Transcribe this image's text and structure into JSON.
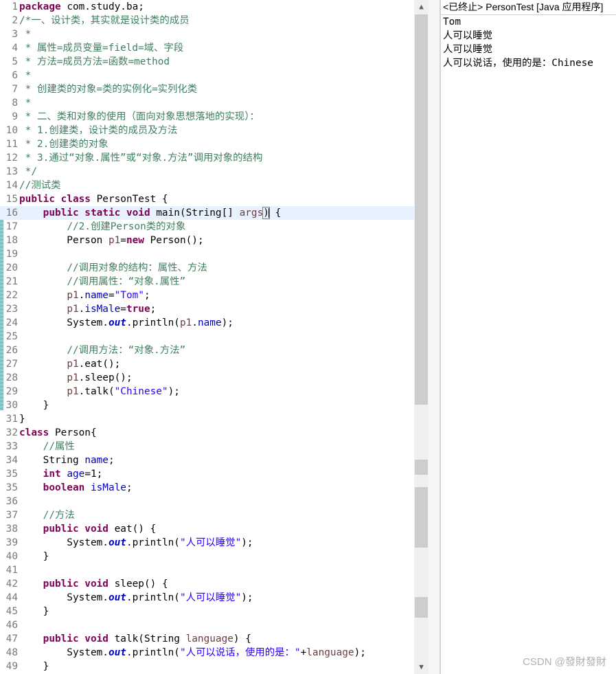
{
  "editor": {
    "lines": [
      {
        "n": "1",
        "segs": [
          {
            "t": "kw",
            "v": "package"
          },
          {
            "t": "p",
            "v": " com.study.ba;"
          }
        ]
      },
      {
        "n": "2",
        "segs": [
          {
            "t": "cm",
            "v": "/*一、设计类，其实就是设计类的成员"
          }
        ]
      },
      {
        "n": "3",
        "segs": [
          {
            "t": "cm",
            "v": " *"
          }
        ]
      },
      {
        "n": "4",
        "segs": [
          {
            "t": "cm",
            "v": " * 属性=成员变量=field=域、字段"
          }
        ]
      },
      {
        "n": "5",
        "segs": [
          {
            "t": "cm",
            "v": " * 方法=成员方法=函数=method"
          }
        ]
      },
      {
        "n": "6",
        "segs": [
          {
            "t": "cm",
            "v": " *"
          }
        ]
      },
      {
        "n": "7",
        "segs": [
          {
            "t": "cm",
            "v": " * 创建类的对象=类的实例化=实列化类"
          }
        ]
      },
      {
        "n": "8",
        "segs": [
          {
            "t": "cm",
            "v": " *"
          }
        ]
      },
      {
        "n": "9",
        "segs": [
          {
            "t": "cm",
            "v": " * 二、类和对象的使用（面向对象思想落地的实现）："
          }
        ]
      },
      {
        "n": "10",
        "segs": [
          {
            "t": "cm",
            "v": " * 1.创建类，设计类的成员及方法"
          }
        ]
      },
      {
        "n": "11",
        "segs": [
          {
            "t": "cm",
            "v": " * 2.创建类的对象"
          }
        ]
      },
      {
        "n": "12",
        "segs": [
          {
            "t": "cm",
            "v": " * 3.通过“对象.属性”或“对象.方法”调用对象的结构"
          }
        ]
      },
      {
        "n": "13",
        "segs": [
          {
            "t": "cm",
            "v": " */"
          }
        ]
      },
      {
        "n": "14",
        "segs": [
          {
            "t": "cm",
            "v": "//测试类"
          }
        ]
      },
      {
        "n": "15",
        "segs": [
          {
            "t": "kw",
            "v": "public class"
          },
          {
            "t": "p",
            "v": " PersonTest {"
          }
        ]
      },
      {
        "n": "16",
        "hl": true,
        "segs": [
          {
            "t": "p",
            "v": "    "
          },
          {
            "t": "kw",
            "v": "public static void"
          },
          {
            "t": "p",
            "v": " main(String[] "
          },
          {
            "t": "lv",
            "v": "args"
          },
          {
            "t": "br",
            "v": ")"
          },
          {
            "t": "p",
            "v": " {"
          }
        ]
      },
      {
        "n": "17",
        "segs": [
          {
            "t": "p",
            "v": "        "
          },
          {
            "t": "cm",
            "v": "//2.创建Person类的对象"
          }
        ]
      },
      {
        "n": "18",
        "segs": [
          {
            "t": "p",
            "v": "        Person "
          },
          {
            "t": "lv",
            "v": "p1"
          },
          {
            "t": "p",
            "v": "="
          },
          {
            "t": "kw",
            "v": "new"
          },
          {
            "t": "p",
            "v": " Person();"
          }
        ]
      },
      {
        "n": "19",
        "segs": []
      },
      {
        "n": "20",
        "segs": [
          {
            "t": "p",
            "v": "        "
          },
          {
            "t": "cm",
            "v": "//调用对象的结构：属性、方法"
          }
        ]
      },
      {
        "n": "21",
        "segs": [
          {
            "t": "p",
            "v": "        "
          },
          {
            "t": "cm",
            "v": "//调用属性：“对象.属性”"
          }
        ]
      },
      {
        "n": "22",
        "segs": [
          {
            "t": "p",
            "v": "        "
          },
          {
            "t": "lv",
            "v": "p1"
          },
          {
            "t": "p",
            "v": "."
          },
          {
            "t": "fd",
            "v": "name"
          },
          {
            "t": "p",
            "v": "="
          },
          {
            "t": "st",
            "v": "\"Tom\""
          },
          {
            "t": "p",
            "v": ";"
          }
        ]
      },
      {
        "n": "23",
        "segs": [
          {
            "t": "p",
            "v": "        "
          },
          {
            "t": "lv",
            "v": "p1"
          },
          {
            "t": "p",
            "v": "."
          },
          {
            "t": "fd",
            "v": "isMale"
          },
          {
            "t": "p",
            "v": "="
          },
          {
            "t": "kw",
            "v": "true"
          },
          {
            "t": "p",
            "v": ";"
          }
        ]
      },
      {
        "n": "24",
        "segs": [
          {
            "t": "p",
            "v": "        System."
          },
          {
            "t": "sf",
            "v": "out"
          },
          {
            "t": "p",
            "v": ".println("
          },
          {
            "t": "lv",
            "v": "p1"
          },
          {
            "t": "p",
            "v": "."
          },
          {
            "t": "fd",
            "v": "name"
          },
          {
            "t": "p",
            "v": ");"
          }
        ]
      },
      {
        "n": "25",
        "segs": []
      },
      {
        "n": "26",
        "segs": [
          {
            "t": "p",
            "v": "        "
          },
          {
            "t": "cm",
            "v": "//调用方法：“对象.方法”"
          }
        ]
      },
      {
        "n": "27",
        "segs": [
          {
            "t": "p",
            "v": "        "
          },
          {
            "t": "lv",
            "v": "p1"
          },
          {
            "t": "p",
            "v": ".eat();"
          }
        ]
      },
      {
        "n": "28",
        "segs": [
          {
            "t": "p",
            "v": "        "
          },
          {
            "t": "lv",
            "v": "p1"
          },
          {
            "t": "p",
            "v": ".sleep();"
          }
        ]
      },
      {
        "n": "29",
        "segs": [
          {
            "t": "p",
            "v": "        "
          },
          {
            "t": "lv",
            "v": "p1"
          },
          {
            "t": "p",
            "v": ".talk("
          },
          {
            "t": "st",
            "v": "\"Chinese\""
          },
          {
            "t": "p",
            "v": ");"
          }
        ]
      },
      {
        "n": "30",
        "segs": [
          {
            "t": "p",
            "v": "    }"
          }
        ]
      },
      {
        "n": "31",
        "segs": [
          {
            "t": "p",
            "v": "}"
          }
        ]
      },
      {
        "n": "32",
        "segs": [
          {
            "t": "kw",
            "v": "class"
          },
          {
            "t": "p",
            "v": " Person{"
          }
        ]
      },
      {
        "n": "33",
        "segs": [
          {
            "t": "p",
            "v": "    "
          },
          {
            "t": "cm",
            "v": "//属性"
          }
        ]
      },
      {
        "n": "34",
        "segs": [
          {
            "t": "p",
            "v": "    String "
          },
          {
            "t": "fd",
            "v": "name"
          },
          {
            "t": "p",
            "v": ";"
          }
        ]
      },
      {
        "n": "35",
        "segs": [
          {
            "t": "p",
            "v": "    "
          },
          {
            "t": "kw",
            "v": "int"
          },
          {
            "t": "p",
            "v": " "
          },
          {
            "t": "fd",
            "v": "age"
          },
          {
            "t": "p",
            "v": "=1;"
          }
        ]
      },
      {
        "n": "35",
        "segs": [
          {
            "t": "p",
            "v": "    "
          },
          {
            "t": "kw",
            "v": "boolean"
          },
          {
            "t": "p",
            "v": " "
          },
          {
            "t": "fd",
            "v": "isMale"
          },
          {
            "t": "p",
            "v": ";"
          }
        ]
      },
      {
        "n": "36",
        "segs": []
      },
      {
        "n": "37",
        "segs": [
          {
            "t": "p",
            "v": "    "
          },
          {
            "t": "cm",
            "v": "//方法"
          }
        ]
      },
      {
        "n": "38",
        "segs": [
          {
            "t": "p",
            "v": "    "
          },
          {
            "t": "kw",
            "v": "public void"
          },
          {
            "t": "p",
            "v": " eat() {"
          }
        ]
      },
      {
        "n": "39",
        "segs": [
          {
            "t": "p",
            "v": "        System."
          },
          {
            "t": "sf",
            "v": "out"
          },
          {
            "t": "p",
            "v": ".println("
          },
          {
            "t": "st",
            "v": "\"人可以睡觉\""
          },
          {
            "t": "p",
            "v": ");"
          }
        ]
      },
      {
        "n": "40",
        "segs": [
          {
            "t": "p",
            "v": "    }"
          }
        ]
      },
      {
        "n": "41",
        "segs": []
      },
      {
        "n": "42",
        "segs": [
          {
            "t": "p",
            "v": "    "
          },
          {
            "t": "kw",
            "v": "public void"
          },
          {
            "t": "p",
            "v": " sleep() {"
          }
        ]
      },
      {
        "n": "44",
        "segs": [
          {
            "t": "p",
            "v": "        System."
          },
          {
            "t": "sf",
            "v": "out"
          },
          {
            "t": "p",
            "v": ".println("
          },
          {
            "t": "st",
            "v": "\"人可以睡觉\""
          },
          {
            "t": "p",
            "v": ");"
          }
        ]
      },
      {
        "n": "45",
        "segs": [
          {
            "t": "p",
            "v": "    }"
          }
        ]
      },
      {
        "n": "46",
        "segs": []
      },
      {
        "n": "47",
        "segs": [
          {
            "t": "p",
            "v": "    "
          },
          {
            "t": "kw",
            "v": "public void"
          },
          {
            "t": "p",
            "v": " talk(String "
          },
          {
            "t": "lv",
            "v": "language"
          },
          {
            "t": "p",
            "v": ") {"
          }
        ]
      },
      {
        "n": "48",
        "segs": [
          {
            "t": "p",
            "v": "        System."
          },
          {
            "t": "sf",
            "v": "out"
          },
          {
            "t": "p",
            "v": ".println("
          },
          {
            "t": "st",
            "v": "\"人可以说话，使用的是：\""
          },
          {
            "t": "p",
            "v": "+"
          },
          {
            "t": "lv",
            "v": "language"
          },
          {
            "t": "p",
            "v": ");"
          }
        ]
      },
      {
        "n": "49",
        "segs": [
          {
            "t": "p",
            "v": "    }"
          }
        ]
      }
    ]
  },
  "scrollbar": {
    "up_icon": "▲",
    "down_icon": "▼"
  },
  "console": {
    "title": "<已终止> PersonTest [Java 应用程序]",
    "output": [
      "Tom",
      "人可以睡觉",
      "人可以睡觉",
      "人可以说话，使用的是：Chinese"
    ]
  },
  "watermark": "CSDN @發財發財",
  "colors": {
    "keyword": "#7f0055",
    "comment": "#3f7f5f",
    "string": "#2a00ff",
    "field": "#0000c0",
    "local_variable": "#6a3e3e",
    "current_line": "#e8f2fe"
  }
}
